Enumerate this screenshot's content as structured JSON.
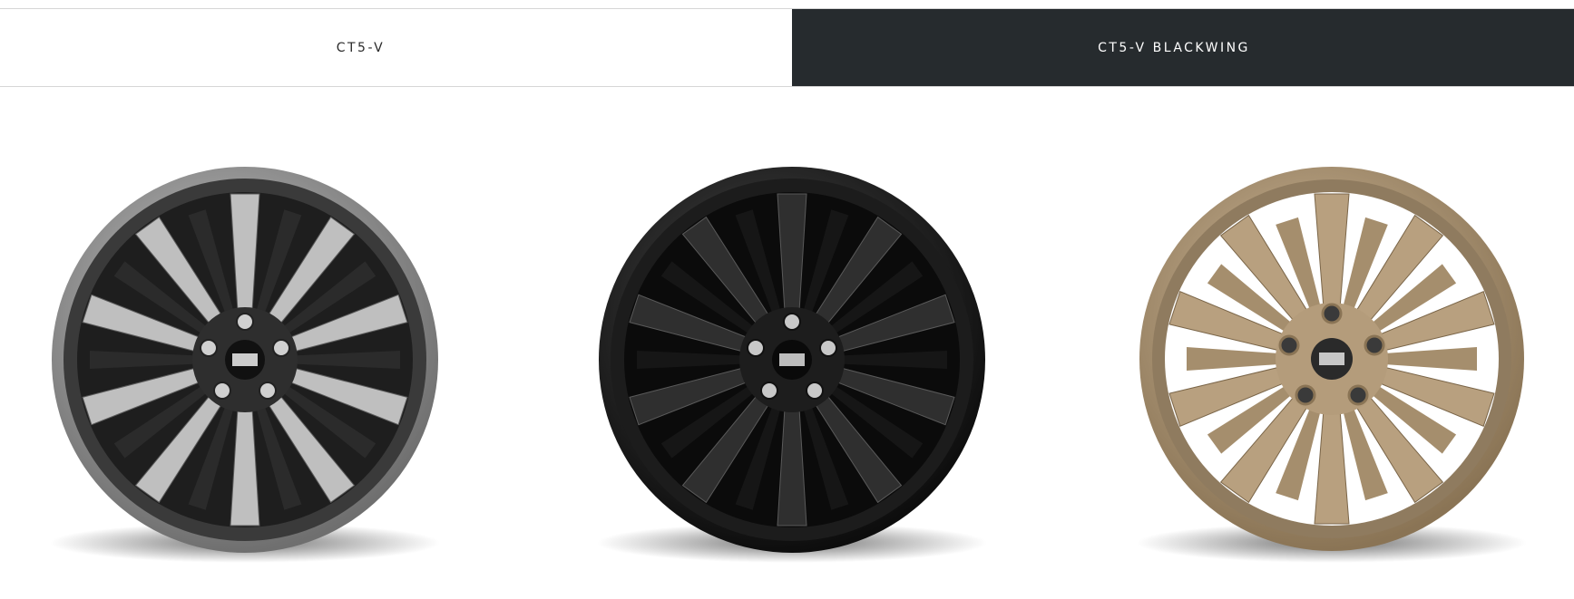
{
  "tabs": [
    {
      "label": "CT5-V",
      "selected": false
    },
    {
      "label": "CT5-V BLACKWING",
      "selected": true
    }
  ],
  "colors": {
    "tab_selected_bg": "#262b2e",
    "tab_selected_text": "#ffffff",
    "tab_text": "#2a2a2a",
    "divider": "#d6d6d6"
  },
  "wheels": [
    {
      "finish": "machined-silver-dark",
      "icon": "wheel-image"
    },
    {
      "finish": "gloss-black",
      "icon": "wheel-image"
    },
    {
      "finish": "bronze",
      "icon": "wheel-image"
    }
  ]
}
